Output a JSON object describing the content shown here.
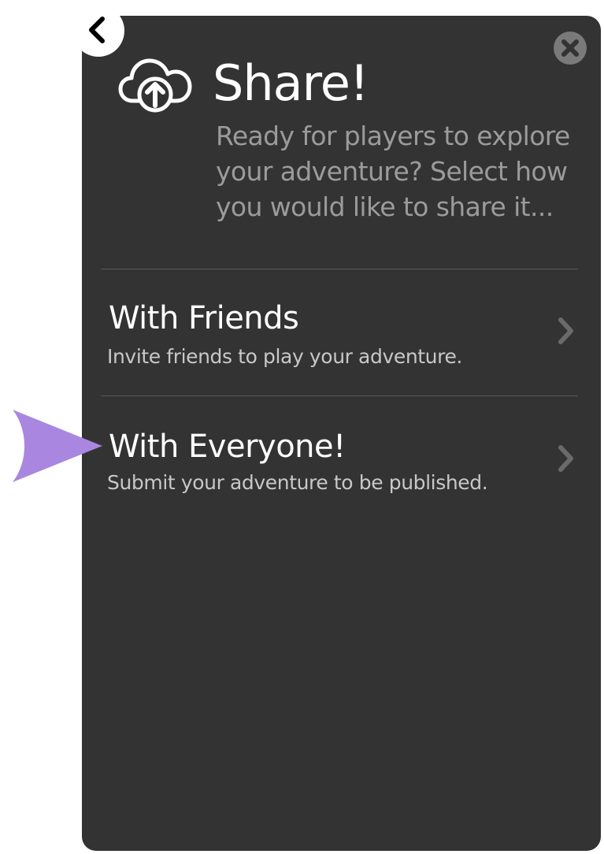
{
  "dialog": {
    "title": "Share!",
    "subtitle": "Ready for players to explore your adventure? Select how you would like to share it...",
    "icons": {
      "back": "chevron-left-icon",
      "close": "close-icon",
      "header": "cloud-upload-icon",
      "pointer": "pointer-arrow-icon"
    },
    "options": [
      {
        "title": "With Friends",
        "description": "Invite friends to play your adventure."
      },
      {
        "title": "With Everyone!",
        "description": "Submit your adventure to be published."
      }
    ]
  },
  "colors": {
    "panel_bg": "#333333",
    "title_text": "#ffffff",
    "subtitle_text": "#9b9b9b",
    "description_text": "#c8c8c8",
    "divider": "#5a5a5a",
    "pointer_arrow": "#a987e0"
  }
}
